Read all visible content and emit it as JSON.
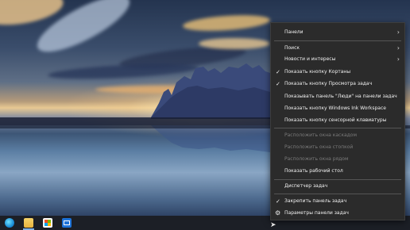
{
  "context_menu": {
    "items": [
      {
        "label": "Панели",
        "submenu": true,
        "enabled": true
      },
      {
        "label": "Поиск",
        "submenu": true,
        "enabled": true
      },
      {
        "label": "Новости и интересы",
        "submenu": true,
        "enabled": true
      },
      {
        "label": "Показать кнопку Кортаны",
        "checked": true,
        "enabled": true
      },
      {
        "label": "Показать кнопку Просмотра задач",
        "checked": true,
        "enabled": true
      },
      {
        "label": "Показывать панель \"Люди\" на панели задач",
        "enabled": true
      },
      {
        "label": "Показать кнопку Windows Ink Workspace",
        "enabled": true
      },
      {
        "label": "Показать кнопку сенсорной клавиатуры",
        "enabled": true
      },
      {
        "label": "Расположить окна каскадом",
        "enabled": false
      },
      {
        "label": "Расположить окна стопкой",
        "enabled": false
      },
      {
        "label": "Расположить окна рядом",
        "enabled": false
      },
      {
        "label": "Показать рабочий стол",
        "enabled": true
      },
      {
        "label": "Диспетчер задач",
        "enabled": true
      },
      {
        "label": "Закрепить панель задач",
        "checked": true,
        "enabled": true
      },
      {
        "label": "Параметры панели задач",
        "icon": "gear-icon",
        "enabled": true
      }
    ],
    "submenu_glyph": "›",
    "check_glyph": "✓",
    "gear_glyph": "⚙"
  },
  "taskbar": {
    "pinned": [
      {
        "name": "edge-icon"
      },
      {
        "name": "file-explorer-icon"
      },
      {
        "name": "microsoft-store-icon"
      },
      {
        "name": "mail-icon"
      }
    ]
  },
  "colors": {
    "menu_background": "#2b2b2b",
    "menu_text": "#f2f2f2",
    "menu_disabled_text": "#7a7a7a",
    "taskbar_background": "#1c1f26"
  }
}
